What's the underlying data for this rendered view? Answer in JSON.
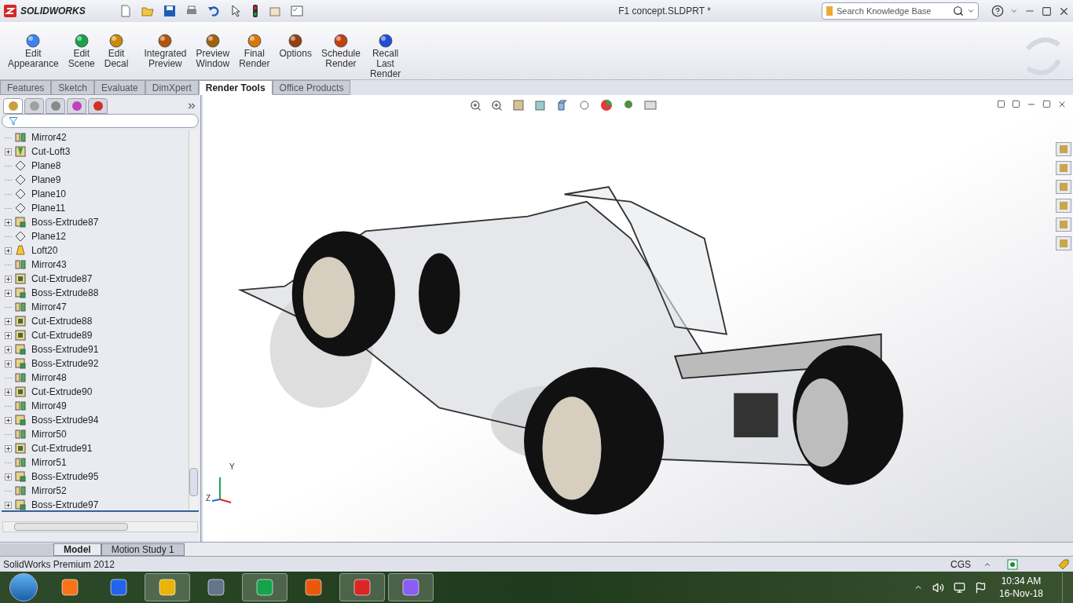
{
  "app": {
    "logo": "SOLIDWORKS",
    "document_title": "F1 concept.SLDPRT *",
    "search": {
      "placeholder": "Search Knowledge Base"
    }
  },
  "commands": [
    {
      "label": "Edit Appearance",
      "kind": "appearance"
    },
    {
      "label": "Edit Scene",
      "kind": "scene"
    },
    {
      "label": "Edit Decal",
      "kind": "decal"
    },
    {
      "label": "Integrated Preview",
      "kind": "preview"
    },
    {
      "label": "Preview Window",
      "kind": "window"
    },
    {
      "label": "Final Render",
      "kind": "render"
    },
    {
      "label": "Options",
      "kind": "options"
    },
    {
      "label": "Schedule Render",
      "kind": "schedule"
    },
    {
      "label": "Recall Last Render",
      "kind": "recall"
    }
  ],
  "tabs": [
    {
      "label": "Features",
      "selected": false
    },
    {
      "label": "Sketch",
      "selected": false
    },
    {
      "label": "Evaluate",
      "selected": false
    },
    {
      "label": "DimXpert",
      "selected": false
    },
    {
      "label": "Render Tools",
      "selected": true
    },
    {
      "label": "Office Products",
      "selected": false
    }
  ],
  "tree": [
    {
      "label": "Mirror42",
      "kind": "mirror",
      "expandable": false
    },
    {
      "label": "Cut-Loft3",
      "kind": "cutloft",
      "expandable": true
    },
    {
      "label": "Plane8",
      "kind": "plane",
      "expandable": false
    },
    {
      "label": "Plane9",
      "kind": "plane",
      "expandable": false
    },
    {
      "label": "Plane10",
      "kind": "plane",
      "expandable": false
    },
    {
      "label": "Plane11",
      "kind": "plane",
      "expandable": false
    },
    {
      "label": "Boss-Extrude87",
      "kind": "boss",
      "expandable": true
    },
    {
      "label": "Plane12",
      "kind": "plane",
      "expandable": false
    },
    {
      "label": "Loft20",
      "kind": "loft",
      "expandable": true
    },
    {
      "label": "Mirror43",
      "kind": "mirror",
      "expandable": false
    },
    {
      "label": "Cut-Extrude87",
      "kind": "cut",
      "expandable": true
    },
    {
      "label": "Boss-Extrude88",
      "kind": "boss",
      "expandable": true
    },
    {
      "label": "Mirror47",
      "kind": "mirror",
      "expandable": false
    },
    {
      "label": "Cut-Extrude88",
      "kind": "cut",
      "expandable": true
    },
    {
      "label": "Cut-Extrude89",
      "kind": "cut",
      "expandable": true
    },
    {
      "label": "Boss-Extrude91",
      "kind": "boss",
      "expandable": true
    },
    {
      "label": "Boss-Extrude92",
      "kind": "boss",
      "expandable": true
    },
    {
      "label": "Mirror48",
      "kind": "mirror",
      "expandable": false
    },
    {
      "label": "Cut-Extrude90",
      "kind": "cut",
      "expandable": true
    },
    {
      "label": "Mirror49",
      "kind": "mirror",
      "expandable": false
    },
    {
      "label": "Boss-Extrude94",
      "kind": "boss",
      "expandable": true
    },
    {
      "label": "Mirror50",
      "kind": "mirror",
      "expandable": false
    },
    {
      "label": "Cut-Extrude91",
      "kind": "cut",
      "expandable": true
    },
    {
      "label": "Mirror51",
      "kind": "mirror",
      "expandable": false
    },
    {
      "label": "Boss-Extrude95",
      "kind": "boss",
      "expandable": true
    },
    {
      "label": "Mirror52",
      "kind": "mirror",
      "expandable": false
    },
    {
      "label": "Boss-Extrude97",
      "kind": "boss",
      "expandable": true
    }
  ],
  "triad": {
    "y": "Y",
    "z": "Z"
  },
  "bottom_tabs": [
    {
      "label": "Model",
      "selected": true
    },
    {
      "label": "Motion Study 1",
      "selected": false
    }
  ],
  "status_bar": {
    "text": "SolidWorks Premium 2012",
    "units": "CGS"
  },
  "taskbar": {
    "apps": [
      {
        "kind": "media",
        "active": false
      },
      {
        "kind": "word",
        "active": false
      },
      {
        "kind": "explorer",
        "active": true
      },
      {
        "kind": "scanner",
        "active": false
      },
      {
        "kind": "chrome",
        "active": true
      },
      {
        "kind": "powerpoint",
        "active": false
      },
      {
        "kind": "solidworks",
        "active": true
      },
      {
        "kind": "paint",
        "active": true
      }
    ],
    "time": "10:34 AM",
    "date": "16-Nov-18"
  }
}
